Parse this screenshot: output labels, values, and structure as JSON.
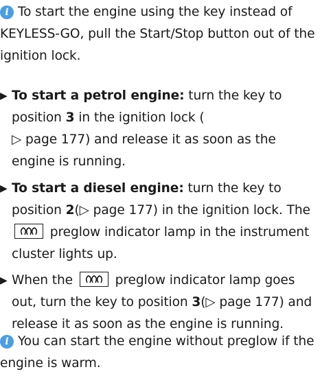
{
  "info1": {
    "text": "To start the engine using the key instead of KEYLESS-GO, pull the Start/Stop button out of the ignition lock."
  },
  "bullets": [
    {
      "bold": "To start a petrol engine:",
      "t1": " turn the key to position ",
      "pos": "3",
      "t2": " in the ignition lock (",
      "ref": "▷ page 177",
      "t3": ") and release it as soon as the engine is running."
    },
    {
      "bold": "To start a diesel engine:",
      "t1": " turn the key to position ",
      "pos": "2",
      "t2": "(",
      "ref": "▷ page 177",
      "t3": ") in the ignition lock. The ",
      "t4": " preglow indicator lamp in the instrument cluster lights up."
    },
    {
      "t1": "When the ",
      "t2": " preglow indicator lamp goes out, turn the key to position ",
      "pos": "3",
      "t3": "(",
      "ref": "▷ page 177",
      "t4": ") and release it as soon as the engine is running."
    }
  ],
  "info2": {
    "text": "You can start the engine without preglow if the engine is warm."
  },
  "icons": {
    "info": "info-icon",
    "bullet": "triangle-bullet-icon",
    "preglow": "preglow-lamp-icon"
  },
  "colors": {
    "info_icon": "#4d9de0",
    "text": "#1a1a1a"
  }
}
